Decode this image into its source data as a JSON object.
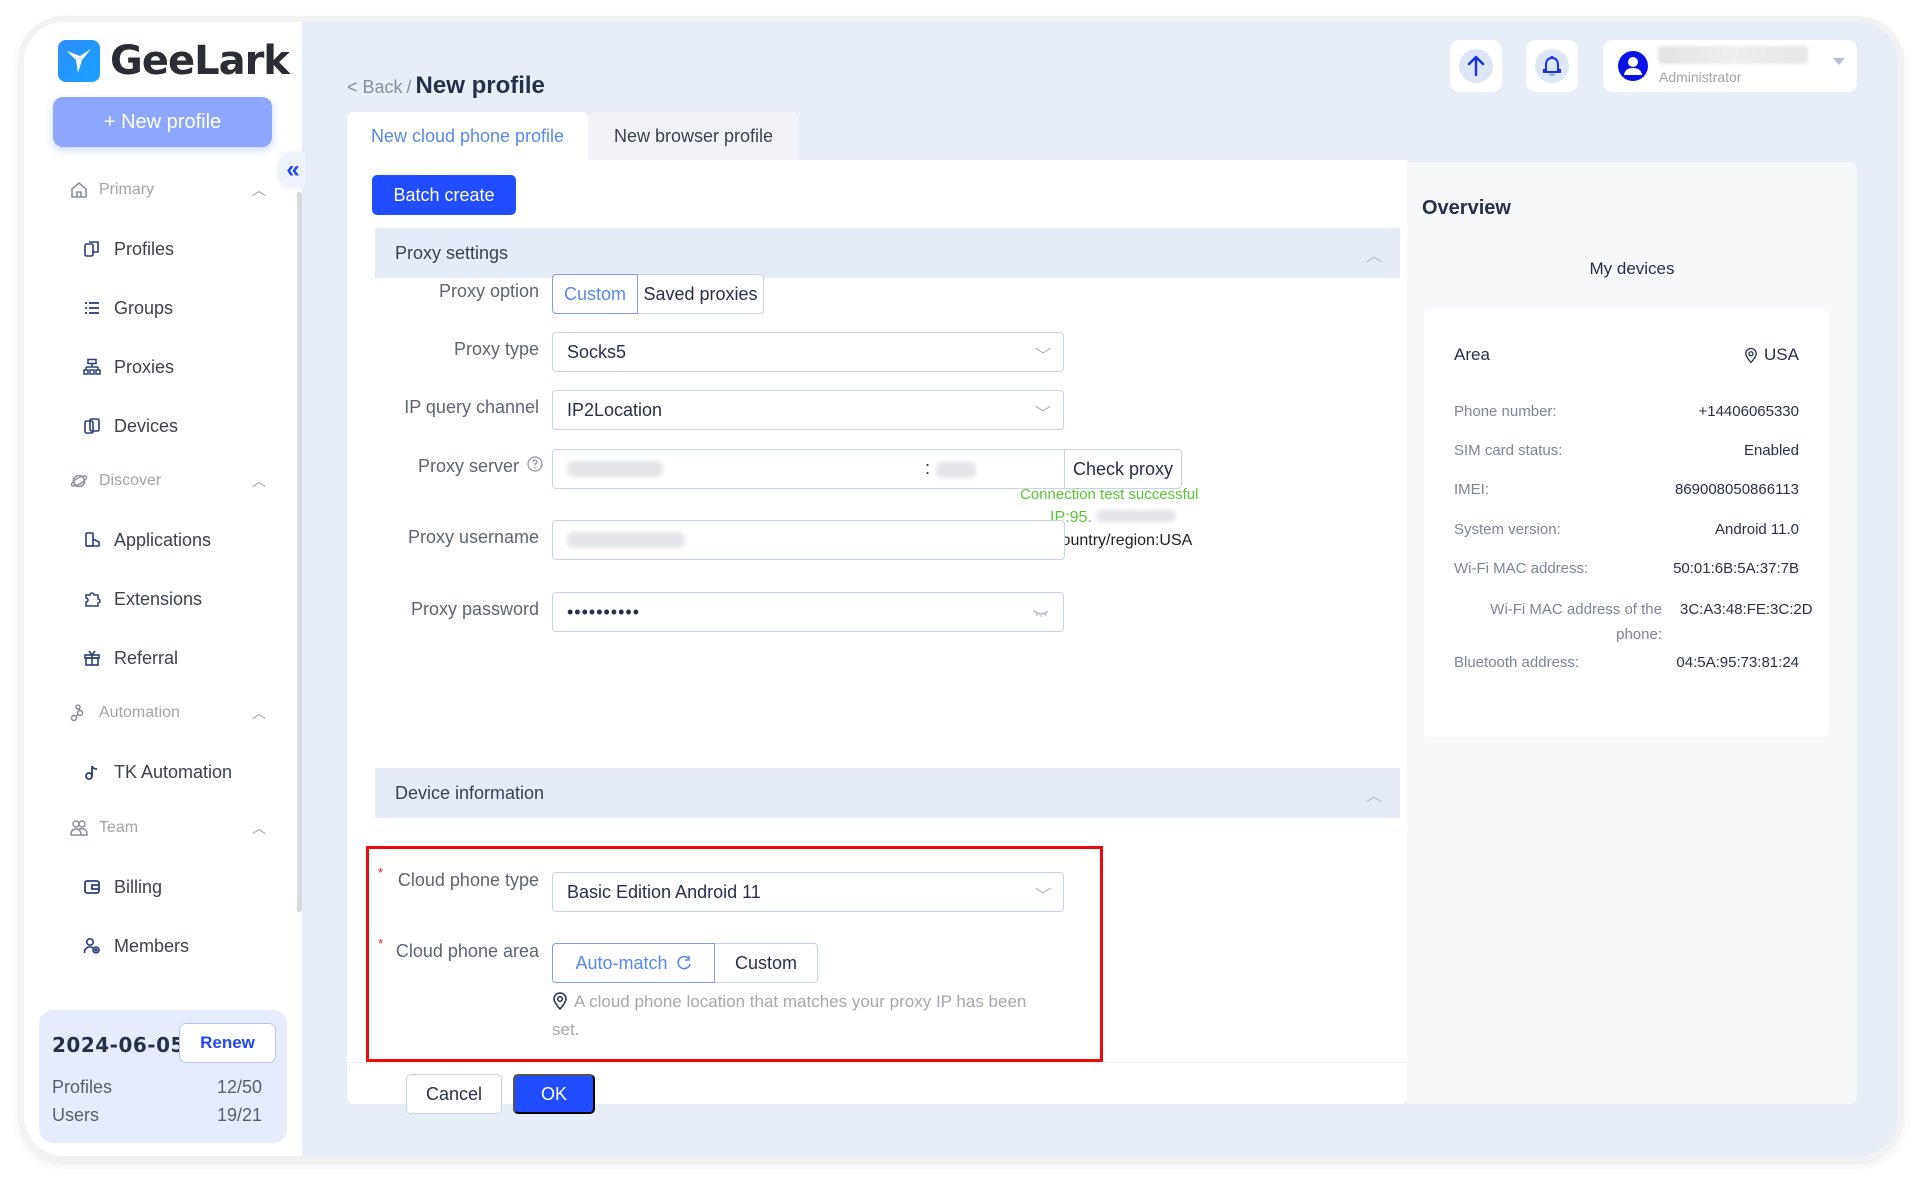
{
  "app": {
    "name": "GeeLark",
    "new_profile_button": "+ New profile"
  },
  "sidebar": {
    "groups": [
      {
        "label": "Primary",
        "icon": "home-icon",
        "items": [
          {
            "label": "Profiles",
            "icon": "profiles-icon"
          },
          {
            "label": "Groups",
            "icon": "list-icon"
          },
          {
            "label": "Proxies",
            "icon": "network-icon"
          },
          {
            "label": "Devices",
            "icon": "devices-icon"
          }
        ]
      },
      {
        "label": "Discover",
        "icon": "planet-icon",
        "items": [
          {
            "label": "Applications",
            "icon": "applications-icon"
          },
          {
            "label": "Extensions",
            "icon": "puzzle-icon"
          },
          {
            "label": "Referral",
            "icon": "gift-icon"
          }
        ]
      },
      {
        "label": "Automation",
        "icon": "automation-icon",
        "items": [
          {
            "label": "TK Automation",
            "icon": "tiktok-icon"
          }
        ]
      },
      {
        "label": "Team",
        "icon": "team-icon",
        "items": [
          {
            "label": "Billing",
            "icon": "wallet-icon"
          },
          {
            "label": "Members",
            "icon": "members-icon"
          }
        ]
      }
    ],
    "plan": {
      "expiry_date": "2024-06-05",
      "renew_label": "Renew",
      "profiles_label": "Profiles",
      "profiles_value": "12/50",
      "users_label": "Users",
      "users_value": "19/21"
    }
  },
  "header": {
    "back_label": "< Back",
    "separator": "/",
    "title": "New profile",
    "user_role": "Administrator"
  },
  "tabs": [
    {
      "label": "New cloud phone profile",
      "active": true
    },
    {
      "label": "New browser profile",
      "active": false
    }
  ],
  "form": {
    "batch_create_label": "Batch create",
    "proxy_section_title": "Proxy settings",
    "proxy_option_label": "Proxy option",
    "proxy_options": [
      "Custom",
      "Saved proxies"
    ],
    "proxy_option_selected": "Custom",
    "proxy_type_label": "Proxy type",
    "proxy_type_value": "Socks5",
    "ip_query_label": "IP query channel",
    "ip_query_value": "IP2Location",
    "proxy_server_label": "Proxy server",
    "proxy_server_port_sep": ":",
    "check_proxy_label": "Check proxy",
    "connection_status": "Connection test successful",
    "ip_prefix": "IP:95.",
    "country_region": "Country/region:USA",
    "proxy_username_label": "Proxy username",
    "proxy_password_label": "Proxy password",
    "proxy_password_value": "••••••••••",
    "device_section_title": "Device information",
    "cloud_phone_type_label": "Cloud phone type",
    "cloud_phone_type_value": "Basic Edition Android 11",
    "cloud_phone_area_label": "Cloud phone area",
    "area_options": [
      "Auto-match",
      "Custom"
    ],
    "area_option_selected": "Auto-match",
    "area_hint": "A cloud phone location that matches your proxy IP has been set.",
    "cancel_label": "Cancel",
    "ok_label": "OK"
  },
  "overview": {
    "title": "Overview",
    "subtitle": "My devices",
    "area_label": "Area",
    "area_value": "USA",
    "details": [
      {
        "key": "Phone number:",
        "value": "+14406065330"
      },
      {
        "key": "SIM card status:",
        "value": "Enabled"
      },
      {
        "key": "IMEI:",
        "value": "869008050866113"
      },
      {
        "key": "System version:",
        "value": "Android 11.0"
      },
      {
        "key": "Wi-Fi MAC address:",
        "value": "50:01:6B:5A:37:7B"
      }
    ],
    "phone_wifi_mac_key": "Wi-Fi MAC address of the phone:",
    "phone_wifi_mac_value": "3C:A3:48:FE:3C:2D",
    "bluetooth_key": "Bluetooth address:",
    "bluetooth_value": "04:5A:95:73:81:24"
  },
  "colors": {
    "primary": "#1f4dff",
    "accent_light": "#8ea6fb",
    "success": "#5cc43a",
    "highlight_box": "#ee0a0a",
    "background": "#e7eef8"
  }
}
